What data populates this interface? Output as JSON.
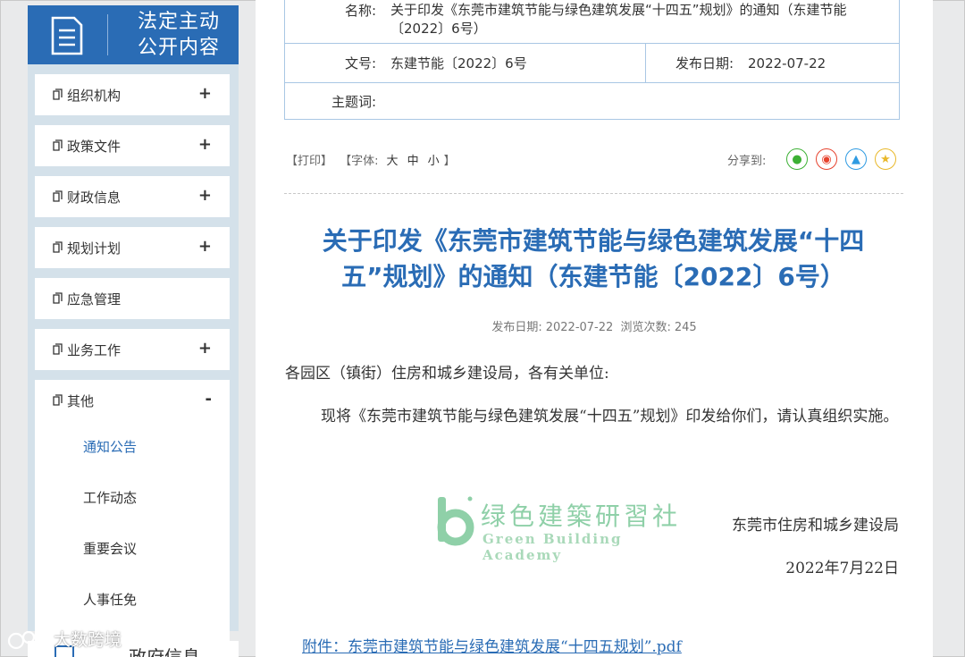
{
  "sidebar": {
    "header_line1": "法定主动",
    "header_line2": "公开内容",
    "items": [
      {
        "label": "组织机构",
        "toggle": "+"
      },
      {
        "label": "政策文件",
        "toggle": "+"
      },
      {
        "label": "财政信息",
        "toggle": "+"
      },
      {
        "label": "规划计划",
        "toggle": "+"
      },
      {
        "label": "应急管理",
        "toggle": ""
      },
      {
        "label": "业务工作",
        "toggle": "+"
      },
      {
        "label": "其他",
        "toggle": "-"
      }
    ],
    "sub_items": [
      "通知公告",
      "工作动态",
      "重要会议",
      "人事任免"
    ],
    "bottom_label": "政府信息"
  },
  "watermark": {
    "text": "大数跨境"
  },
  "info": {
    "name_label": "名称:",
    "name_value": "关于印发《东莞市建筑节能与绿色建筑发展“十四五”规划》的通知（东建节能〔2022〕6号）",
    "doc_no_label": "文号:",
    "doc_no_value": "东建节能〔2022〕6号",
    "pub_date_label": "发布日期:",
    "pub_date_value": "2022-07-22",
    "keywords_label": "主题词:",
    "keywords_value": ""
  },
  "toolbar": {
    "print": "【打印】",
    "font_prefix": "【字体:",
    "font_large": "大",
    "font_medium": "中",
    "font_small": "小",
    "font_suffix": "】",
    "share_label": "分享到:"
  },
  "share_icons": [
    {
      "name": "wechat-icon",
      "glyph": "●",
      "color": "#3cb034"
    },
    {
      "name": "weibo-icon",
      "glyph": "◉",
      "color": "#e6432e"
    },
    {
      "name": "qq-icon",
      "glyph": "▲",
      "color": "#2f9be2"
    },
    {
      "name": "qzone-icon",
      "glyph": "★",
      "color": "#e9b82a"
    }
  ],
  "article": {
    "title_line1": "关于印发《东莞市建筑节能与绿色建筑发展“十四",
    "title_line2": "五”规划》的通知（东建节能〔2022〕6号）",
    "meta_date_label": "发布日期:",
    "meta_date": "2022-07-22",
    "meta_views_label": "浏览次数:",
    "meta_views": "245",
    "salutation": "各园区（镇街）住房和城乡建设局，各有关单位:",
    "paragraph": "现将《东莞市建筑节能与绿色建筑发展“十四五”规划》印发给你们，请认真组织实施。",
    "stamp_cn": "绿色建築研習社",
    "stamp_en": "Green Building Academy",
    "signature": "东莞市住房和城乡建设局",
    "date": "2022年7月22日",
    "attachment": "附件：东莞市建筑节能与绿色建筑发展“十四五规划”.pdf"
  }
}
